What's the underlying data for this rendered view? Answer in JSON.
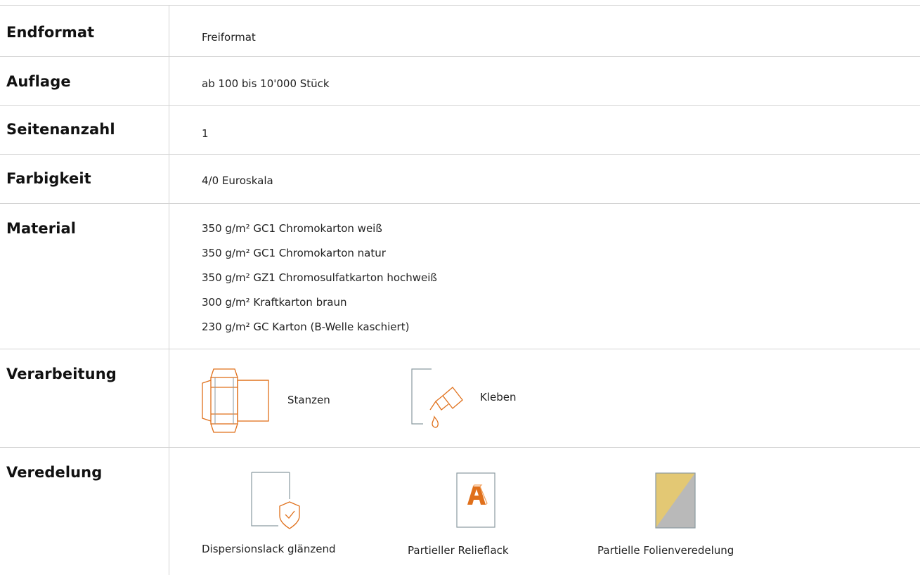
{
  "rows": {
    "endformat": {
      "label": "Endformat",
      "value": "Freiformat"
    },
    "auflage": {
      "label": "Auflage",
      "value": "ab 100 bis 10'000 Stück"
    },
    "seitenanzahl": {
      "label": "Seitenanzahl",
      "value": "1"
    },
    "farbigkeit": {
      "label": "Farbigkeit",
      "value": "4/0 Euroskala"
    },
    "material": {
      "label": "Material",
      "items": [
        "350 g/m² GC1 Chromokarton weiß",
        "350 g/m² GC1 Chromokarton natur",
        "350 g/m² GZ1 Chromosulfatkarton hochweiß",
        "300 g/m² Kraftkarton braun",
        "230 g/m² GC Karton (B-Welle kaschiert)"
      ]
    },
    "verarbeitung": {
      "label": "Verarbeitung",
      "options": [
        {
          "label": "Stanzen",
          "icon": "die-cut-box-icon"
        },
        {
          "label": "Kleben",
          "icon": "glue-bottle-icon"
        }
      ]
    },
    "veredelung": {
      "label": "Veredelung",
      "options": [
        {
          "label": "Dispersionslack glänzend",
          "icon": "shield-check-icon"
        },
        {
          "label": "Partieller Relieflack",
          "icon": "relief-letter-a-icon"
        },
        {
          "label": "Partielle Folienveredelung",
          "icon": "foil-split-icon"
        }
      ]
    }
  },
  "colors": {
    "accent": "#e0701b",
    "line": "#d4d4d4",
    "icon_gray": "#8a9aa0",
    "foil_gold": "#e3c874",
    "foil_silver": "#b9b9b9"
  }
}
